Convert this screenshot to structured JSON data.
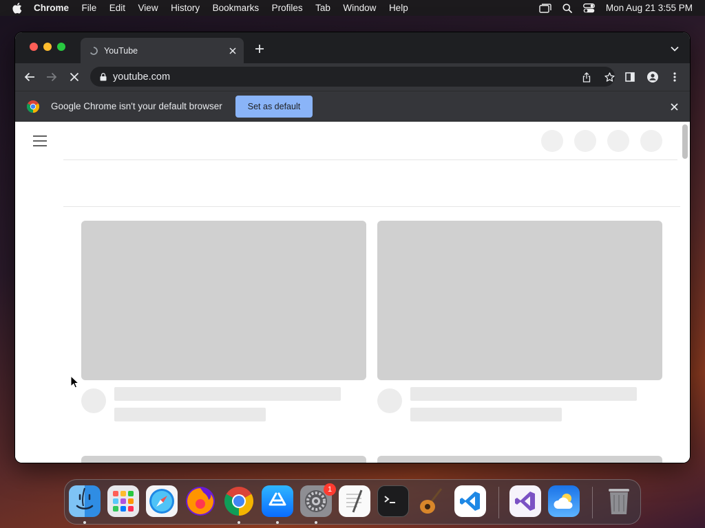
{
  "menubar": {
    "app_name": "Chrome",
    "items": [
      "File",
      "Edit",
      "View",
      "History",
      "Bookmarks",
      "Profiles",
      "Tab",
      "Window",
      "Help"
    ],
    "clock": "Mon Aug 21  3:55 PM"
  },
  "browser": {
    "tab": {
      "title": "YouTube"
    },
    "address": {
      "url": "youtube.com"
    },
    "infobar": {
      "message": "Google Chrome isn't your default browser",
      "button_label": "Set as default"
    }
  },
  "dock": {
    "apps": [
      "Finder",
      "Launchpad",
      "Safari",
      "Firefox",
      "Google Chrome",
      "App Store",
      "System Settings",
      "TextEdit",
      "Terminal",
      "GarageBand",
      "Visual Studio Code",
      "Visual Studio",
      "Weather",
      "Trash"
    ],
    "system_settings_badge": "1"
  },
  "colors": {
    "accent": "#8ab4f8",
    "toolbar": "#35363a",
    "tabstrip": "#1e1f22",
    "skeleton": "#d0d0d0"
  }
}
